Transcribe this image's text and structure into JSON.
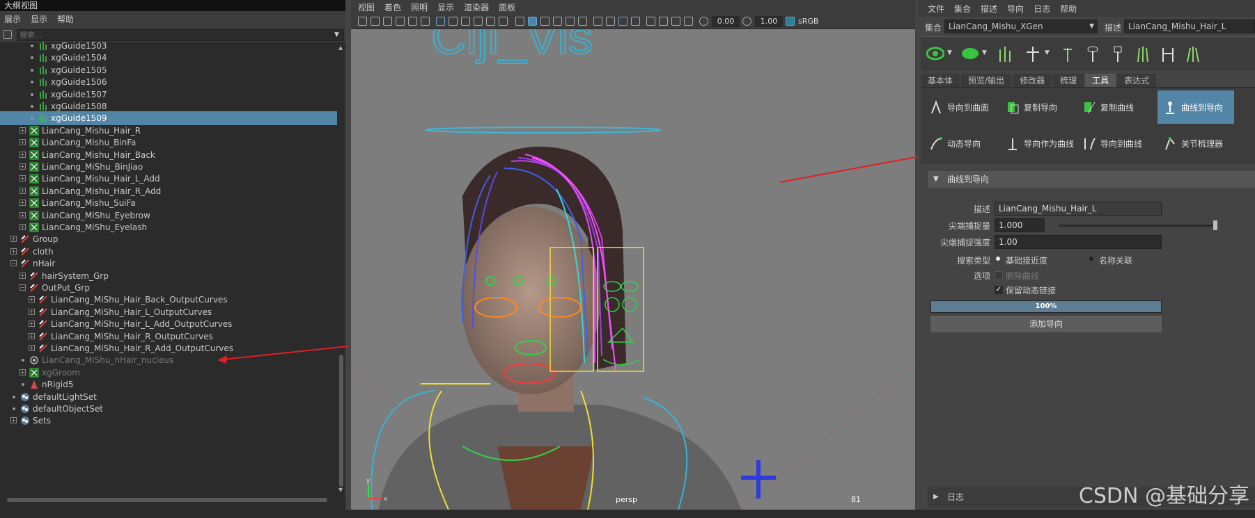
{
  "outliner": {
    "title": "大纲视图",
    "menu": [
      "展示",
      "显示",
      "帮助"
    ],
    "search_placeholder": "搜索...",
    "rows": [
      {
        "label": "xgGuide1503",
        "indent": 3,
        "icon": "guide",
        "expand": "none"
      },
      {
        "label": "xgGuide1504",
        "indent": 3,
        "icon": "guide",
        "expand": "none"
      },
      {
        "label": "xgGuide1505",
        "indent": 3,
        "icon": "guide",
        "expand": "none"
      },
      {
        "label": "xgGuide1506",
        "indent": 3,
        "icon": "guide",
        "expand": "none"
      },
      {
        "label": "xgGuide1507",
        "indent": 3,
        "icon": "guide",
        "expand": "none"
      },
      {
        "label": "xgGuide1508",
        "indent": 3,
        "icon": "guide",
        "expand": "none"
      },
      {
        "label": "xgGuide1509",
        "indent": 3,
        "icon": "guide",
        "expand": "none",
        "selected": true
      },
      {
        "label": "LianCang_Mishu_Hair_R",
        "indent": 2,
        "icon": "xgen",
        "expand": "plus"
      },
      {
        "label": "LianCang_Mishu_BinFa",
        "indent": 2,
        "icon": "xgen",
        "expand": "plus"
      },
      {
        "label": "LianCang_Mishu_Hair_Back",
        "indent": 2,
        "icon": "xgen",
        "expand": "plus"
      },
      {
        "label": "LianCang_MiShu_BinJiao",
        "indent": 2,
        "icon": "xgen",
        "expand": "plus"
      },
      {
        "label": "LianCang_Mishu_Hair_L_Add",
        "indent": 2,
        "icon": "xgen",
        "expand": "plus"
      },
      {
        "label": "LianCang_Mishu_Hair_R_Add",
        "indent": 2,
        "icon": "xgen",
        "expand": "plus"
      },
      {
        "label": "LianCang_Mishu_SuiFa",
        "indent": 2,
        "icon": "xgen",
        "expand": "plus"
      },
      {
        "label": "LianCang_MiShu_Eyebrow",
        "indent": 2,
        "icon": "xgen",
        "expand": "plus"
      },
      {
        "label": "LianCang_MiShu_Eyelash",
        "indent": 2,
        "icon": "xgen",
        "expand": "plus"
      },
      {
        "label": "Group",
        "indent": 1,
        "icon": "transform",
        "expand": "plus"
      },
      {
        "label": "cloth",
        "indent": 1,
        "icon": "transform",
        "expand": "plus"
      },
      {
        "label": "nHair",
        "indent": 1,
        "icon": "transform",
        "expand": "minus"
      },
      {
        "label": "hairSystem_Grp",
        "indent": 2,
        "icon": "transform",
        "expand": "plus"
      },
      {
        "label": "OutPut_Grp",
        "indent": 2,
        "icon": "transform",
        "expand": "minus"
      },
      {
        "label": "LianCang_MiShu_Hair_Back_OutputCurves",
        "indent": 3,
        "icon": "transform",
        "expand": "plus"
      },
      {
        "label": "LianCang_MiShu_Hair_L_OutputCurves",
        "indent": 3,
        "icon": "transform",
        "expand": "plus"
      },
      {
        "label": "LianCang_MiShu_Hair_L_Add_OutputCurves",
        "indent": 3,
        "icon": "transform",
        "expand": "plus"
      },
      {
        "label": "LianCang_MiShu_Hair_R_OutputCurves",
        "indent": 3,
        "icon": "transform",
        "expand": "plus"
      },
      {
        "label": "LianCang_MiShu_Hair_R_Add_OutputCurves",
        "indent": 3,
        "icon": "transform",
        "expand": "plus"
      },
      {
        "label": "LianCang_MiShu_nHair_nucleus",
        "indent": 2,
        "icon": "nucleus",
        "expand": "none",
        "dim": true
      },
      {
        "label": "xgGroom",
        "indent": 2,
        "icon": "xgen",
        "expand": "plus",
        "dim": true
      },
      {
        "label": "nRigid5",
        "indent": 2,
        "icon": "rigid",
        "expand": "none"
      },
      {
        "label": "defaultLightSet",
        "indent": 1,
        "icon": "set",
        "expand": "none"
      },
      {
        "label": "defaultObjectSet",
        "indent": 1,
        "icon": "set",
        "expand": "none"
      },
      {
        "label": "Sets",
        "indent": 1,
        "icon": "set",
        "expand": "plus"
      }
    ]
  },
  "viewport": {
    "menu": [
      "视图",
      "着色",
      "照明",
      "显示",
      "渲染器",
      "面板"
    ],
    "exposure": "0.00",
    "gamma": "1.00",
    "colorspace": "sRGB",
    "camera_label": "persp",
    "scene_text": "Ciji_Vis",
    "frame_number": "81",
    "axis_y": "y",
    "axis_x": "x"
  },
  "right_panel": {
    "menu": [
      "文件",
      "集合",
      "描述",
      "导向",
      "日志",
      "帮助"
    ],
    "collection_label": "集合",
    "collection_value": "LianCang_Mishu_XGen",
    "description_label": "描述",
    "description_value": "LianCang_Mishu_Hair_L",
    "tabs": [
      "基本体",
      "预览/输出",
      "修改器",
      "梳理",
      "工具",
      "表达式"
    ],
    "active_tab": 4,
    "tools": [
      {
        "label": "导向到曲面"
      },
      {
        "label": "复制导向"
      },
      {
        "label": "复制曲线"
      },
      {
        "label": "曲线到导向",
        "active": true
      },
      {
        "label": "动态导向"
      },
      {
        "label": "导向作为曲线"
      },
      {
        "label": "导向到曲线"
      },
      {
        "label": "关节梳理器"
      }
    ],
    "section_title": "曲线到导向",
    "form": {
      "desc_label": "描述",
      "desc_value": "LianCang_Mishu_Hair_L",
      "tip_snap_label": "尖端捕捉量",
      "tip_snap_value": "1.000",
      "tip_snap_fraction": 1.0,
      "tip_strength_label": "尖端捕捉强度",
      "tip_strength_value": "1.00",
      "search_type_label": "搜索类型",
      "search_opt1": "基础接近度",
      "search_opt2": "名称关联",
      "options_label": "选项",
      "delete_curves": "删除曲线",
      "keep_dynamic": "保留动态链接",
      "progress": "100%",
      "progress_fraction": 1.0,
      "add_button": "添加导向"
    },
    "log_label": "日志"
  },
  "watermark": "CSDN @基础分享",
  "colors": {
    "selection": "#5285a6",
    "annotation_arrow": "#e02020",
    "xgen_green": "#39c43f"
  }
}
